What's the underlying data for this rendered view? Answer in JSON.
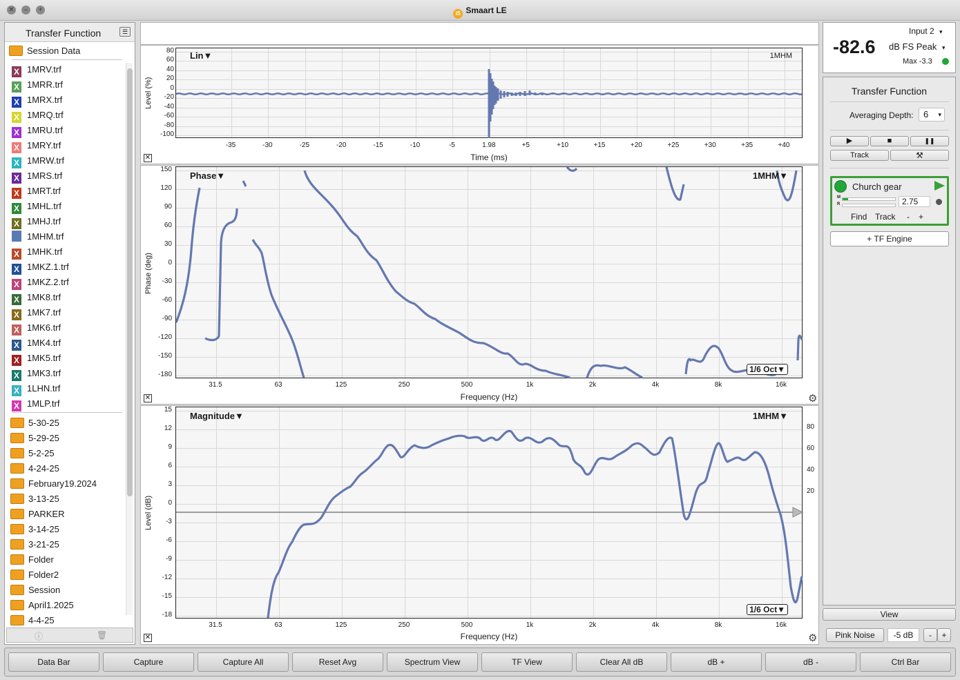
{
  "window": {
    "title": "Smaart LE"
  },
  "left_panel": {
    "header": "Transfer Function",
    "session_label": "Session Data",
    "files": [
      {
        "name": "1MRV.trf",
        "color": "#8a3a5a"
      },
      {
        "name": "1MRR.trf",
        "color": "#5aa05a"
      },
      {
        "name": "1MRX.trf",
        "color": "#1f3fb0"
      },
      {
        "name": "1MRQ.trf",
        "color": "#d6d630"
      },
      {
        "name": "1MRU.trf",
        "color": "#a030d0"
      },
      {
        "name": "1MRY.trf",
        "color": "#f07a7a"
      },
      {
        "name": "1MRW.trf",
        "color": "#2ab5c0"
      },
      {
        "name": "1MRS.trf",
        "color": "#6a2a9a"
      },
      {
        "name": "1MRT.trf",
        "color": "#c0391b"
      },
      {
        "name": "1MHL.trf",
        "color": "#2e8a3a"
      },
      {
        "name": "1MHJ.trf",
        "color": "#6f6f20"
      },
      {
        "name": "1MHM.trf",
        "color": "#5a7ab5"
      },
      {
        "name": "1MHK.trf",
        "color": "#b84a2a"
      },
      {
        "name": "1MKZ.1.trf",
        "color": "#1f4f9a"
      },
      {
        "name": "1MKZ.2.trf",
        "color": "#c0407a"
      },
      {
        "name": "1MK8.trf",
        "color": "#3a6a3a"
      },
      {
        "name": "1MK7.trf",
        "color": "#8a6a1a"
      },
      {
        "name": "1MK6.trf",
        "color": "#c06060"
      },
      {
        "name": "1MK4.trf",
        "color": "#2a5a8a"
      },
      {
        "name": "1MK5.trf",
        "color": "#a02020"
      },
      {
        "name": "1MK3.trf",
        "color": "#1a7a6a"
      },
      {
        "name": "1LHN.trf",
        "color": "#3ab0c0"
      },
      {
        "name": "1MLP.trf",
        "color": "#d03ab0"
      }
    ],
    "folders": [
      "5-30-25",
      "5-29-25",
      "5-2-25",
      "4-24-25",
      "February19.2024",
      "3-13-25",
      "PARKER",
      "3-14-25",
      "3-21-25",
      "Folder",
      "Folder2",
      "Session",
      "April1.2025",
      "4-4-25"
    ]
  },
  "impulse": {
    "label": "Lin▼",
    "trace": "1MHM",
    "y_ticks": [
      "80",
      "60",
      "40",
      "20",
      "0",
      "-20",
      "-40",
      "-60",
      "-80",
      "-100"
    ],
    "x_ticks": [
      "-35",
      "-30",
      "-25",
      "-20",
      "-15",
      "-10",
      "-5",
      "1.98",
      "+5",
      "+10",
      "+15",
      "+20",
      "+25",
      "+30",
      "+35",
      "+40"
    ],
    "xlabel": "Time (ms)",
    "ylabel": "Level (%)"
  },
  "phase": {
    "label": "Phase▼",
    "trace": "1MHM▼",
    "y_ticks": [
      "150",
      "120",
      "90",
      "60",
      "30",
      "0",
      "-30",
      "-60",
      "-90",
      "-120",
      "-150",
      "-180"
    ],
    "x_ticks": [
      "31.5",
      "63",
      "125",
      "250",
      "500",
      "1k",
      "2k",
      "4k",
      "8k",
      "16k"
    ],
    "xlabel": "Frequency (Hz)",
    "ylabel": "Phase (deg)",
    "smoothing": "1/6 Oct▼"
  },
  "magnitude": {
    "label": "Magnitude▼",
    "trace": "1MHM▼",
    "y_ticks": [
      "15",
      "12",
      "9",
      "6",
      "3",
      "0",
      "-3",
      "-6",
      "-9",
      "-12",
      "-15",
      "-18"
    ],
    "y2_ticks": [
      "80",
      "60",
      "40",
      "20"
    ],
    "x_ticks": [
      "31.5",
      "63",
      "125",
      "250",
      "500",
      "1k",
      "2k",
      "4k",
      "8k",
      "16k"
    ],
    "xlabel": "Frequency (Hz)",
    "ylabel": "Level (dB)",
    "smoothing": "1/6 Oct▼"
  },
  "meter": {
    "value": "-82.6",
    "input": "Input 2",
    "mode": "dB FS Peak",
    "max": "Max -3.3"
  },
  "right_panel": {
    "title": "Transfer Function",
    "avg_label": "Averaging Depth:",
    "avg_value": "6",
    "play": "▶",
    "stop": "■",
    "pause": "❚❚",
    "track": "Track",
    "tools": "⚒",
    "engine": {
      "name": "Church gear",
      "delay": "2.75",
      "m": "M",
      "r": "R",
      "find": "Find",
      "track": "Track",
      "minus": "-",
      "plus": "+"
    },
    "tf_engine": "+ TF Engine",
    "view": "View",
    "pink_noise": "Pink Noise",
    "noise_level": "-5 dB",
    "minus": "-",
    "plus": "+"
  },
  "bottom_bar": [
    "Data Bar",
    "Capture",
    "Capture All",
    "Reset Avg",
    "Spectrum View",
    "TF View",
    "Clear All dB",
    "dB +",
    "dB -",
    "Ctrl Bar"
  ],
  "colors": {
    "trace": "#6478b0",
    "accent_green": "#22a53a"
  }
}
